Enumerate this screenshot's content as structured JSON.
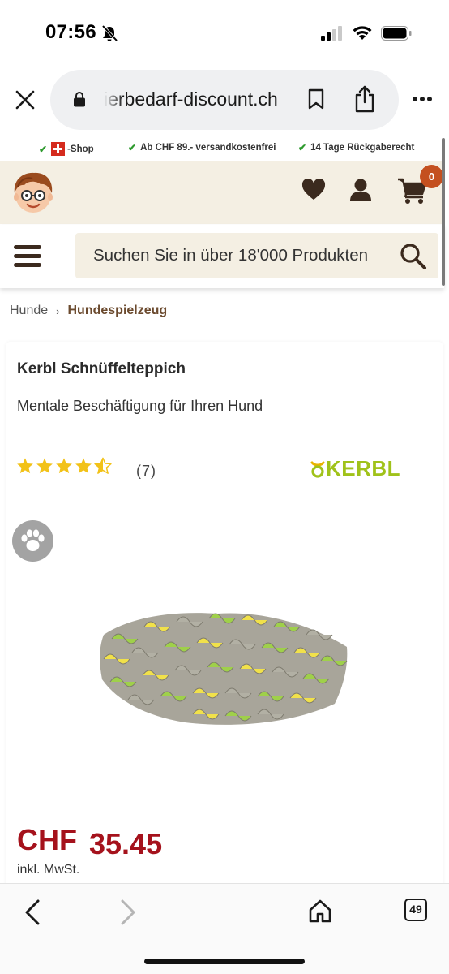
{
  "status_bar": {
    "time": "07:56",
    "icons": [
      "bell-muted-icon",
      "cellular-signal-icon",
      "wifi-icon",
      "battery-icon"
    ]
  },
  "browser": {
    "url": "ierbedarf-discount.ch",
    "icons": [
      "close-icon",
      "lock-icon",
      "bookmark-icon",
      "share-icon",
      "more-icon"
    ]
  },
  "trust_bar": {
    "items": [
      {
        "flag": "swiss-flag-icon",
        "label": "-Shop"
      },
      {
        "label": "Ab CHF 89.- versandkostenfrei"
      },
      {
        "label": "14 Tage Rückgaberecht"
      }
    ]
  },
  "header": {
    "cart_count": "0",
    "icons": [
      "logo",
      "heart-icon",
      "user-icon",
      "cart-icon"
    ]
  },
  "search": {
    "placeholder": "Suchen Sie in über 18'000 Produkten"
  },
  "breadcrumb": {
    "parent": "Hunde",
    "current": "Hundespielzeug"
  },
  "product": {
    "title": "Kerbl Schnüffelteppich",
    "subtitle": "Mentale Beschäftigung für Ihren Hund",
    "rating": 4.5,
    "rating_max": 5,
    "review_count": "(7)",
    "brand": "KERBL",
    "currency": "CHF",
    "price": "35.45",
    "vat_note": "inkl. MwSt."
  },
  "colors": {
    "accent_brown": "#3b2a1e",
    "header_bg": "#f4efe3",
    "price_red": "#a5121c",
    "badge_orange": "#c4501f",
    "star_yellow": "#f2c218",
    "kerbl_green": "#a0c21a"
  },
  "toolbar": {
    "tab_count": "49",
    "icons": [
      "back-icon",
      "forward-icon",
      "home-icon",
      "tabs-icon"
    ]
  }
}
